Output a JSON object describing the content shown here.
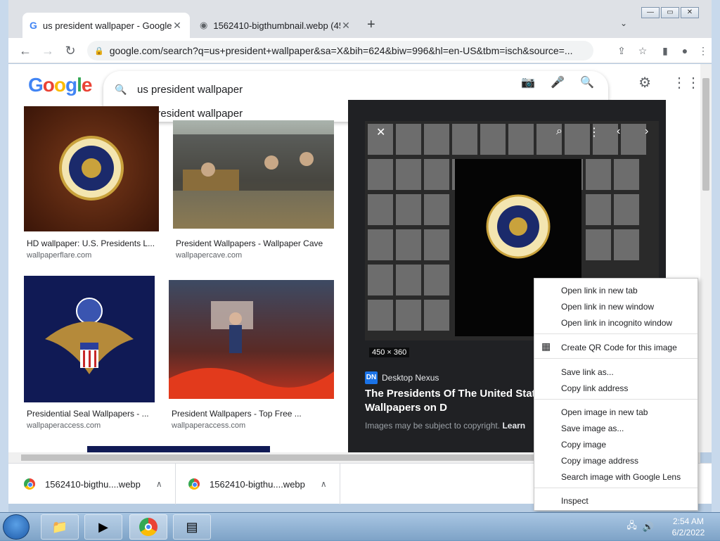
{
  "browser": {
    "tabs": [
      {
        "title": "us president wallpaper - Google",
        "active": true,
        "icon": "google-g-icon"
      },
      {
        "title": "1562410-bigthumbnail.webp (45",
        "active": false,
        "icon": "globe-icon"
      }
    ],
    "new_tab": "+",
    "tab_search": "⌄",
    "url": "google.com/search?q=us+president+wallpaper&sa=X&bih=624&biw=996&hl=en-US&tbm=isch&source=...",
    "window_controls": {
      "minimize": "—",
      "maximize": "▭",
      "close": "✕"
    }
  },
  "google": {
    "logo": "Google",
    "search_value": "us president wallpaper",
    "suggestion": "us president wallpaper"
  },
  "results": [
    {
      "caption": "HD wallpaper: U.S. Presidents L...",
      "source": "wallpaperflare.com"
    },
    {
      "caption": "President Wallpapers - Wallpaper Cave",
      "source": "wallpapercave.com"
    },
    {
      "caption": "Presidential Seal Wallpapers - ...",
      "source": "wallpaperaccess.com"
    },
    {
      "caption": "President Wallpapers - Top Free ...",
      "source": "wallpaperaccess.com"
    }
  ],
  "preview": {
    "dimensions": "450 × 360",
    "site": "Desktop Nexus",
    "site_logo": "DN",
    "title": "The Presidents Of The United States People Background Wallpapers on D",
    "copyright": "Images may be subject to copyright.",
    "learn_more": "Learn"
  },
  "context_menu": {
    "items": [
      "Open link in new tab",
      "Open link in new window",
      "Open link in incognito window",
      "Create QR Code for this image",
      "Save link as...",
      "Copy link address",
      "Open image in new tab",
      "Save image as...",
      "Copy image",
      "Copy image address",
      "Search image with Google Lens",
      "Inspect"
    ]
  },
  "downloads": [
    {
      "name": "1562410-bigthu....webp"
    },
    {
      "name": "1562410-bigthu....webp"
    }
  ],
  "taskbar": {
    "time": "2:54 AM",
    "date": "6/2/2022"
  },
  "colors": {
    "google_blue": "#4285f4",
    "google_red": "#ea4335",
    "google_yellow": "#fbbc05",
    "google_green": "#34a853",
    "preview_bg": "#202124"
  }
}
